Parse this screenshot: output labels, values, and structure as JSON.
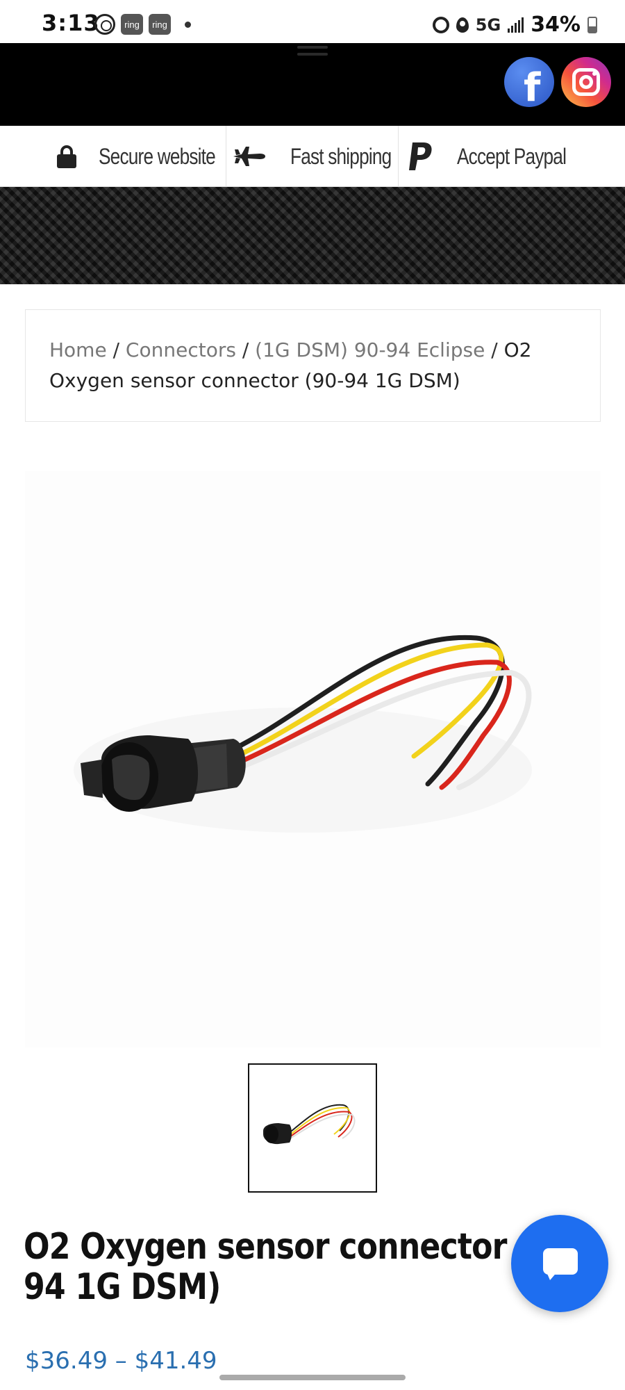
{
  "status_bar": {
    "time": "3:13",
    "ring_badges": [
      "ring",
      "ring"
    ],
    "network": "5G",
    "battery": "34%"
  },
  "header": {
    "menu_icon": "hamburger-icon",
    "social": [
      "facebook-icon",
      "instagram-icon"
    ]
  },
  "trust_bar": {
    "items": [
      {
        "icon": "lock-icon",
        "label": "Secure website"
      },
      {
        "icon": "plane-icon",
        "label": "Fast shipping"
      },
      {
        "icon": "paypal-icon",
        "label": "Accept Paypal"
      }
    ]
  },
  "breadcrumb": {
    "home": "Home",
    "category": "Connectors",
    "subcategory": "(1G DSM) 90-94 Eclipse",
    "separator": " / ",
    "current": "O2 Oxygen sensor connector (90-94 1G DSM)"
  },
  "product": {
    "title": "O2 Oxygen sensor connector (90-94 1G DSM)",
    "price": "$36.49 – $41.49",
    "wire_colors": [
      "#1f1f1f",
      "#f2d21b",
      "#d9261c",
      "#f4f4f4"
    ]
  },
  "colors": {
    "header_bg": "#000000",
    "chat_accent": "#1e6ef0",
    "price": "#2a6fb0",
    "breadcrumb_link": "#777777"
  }
}
